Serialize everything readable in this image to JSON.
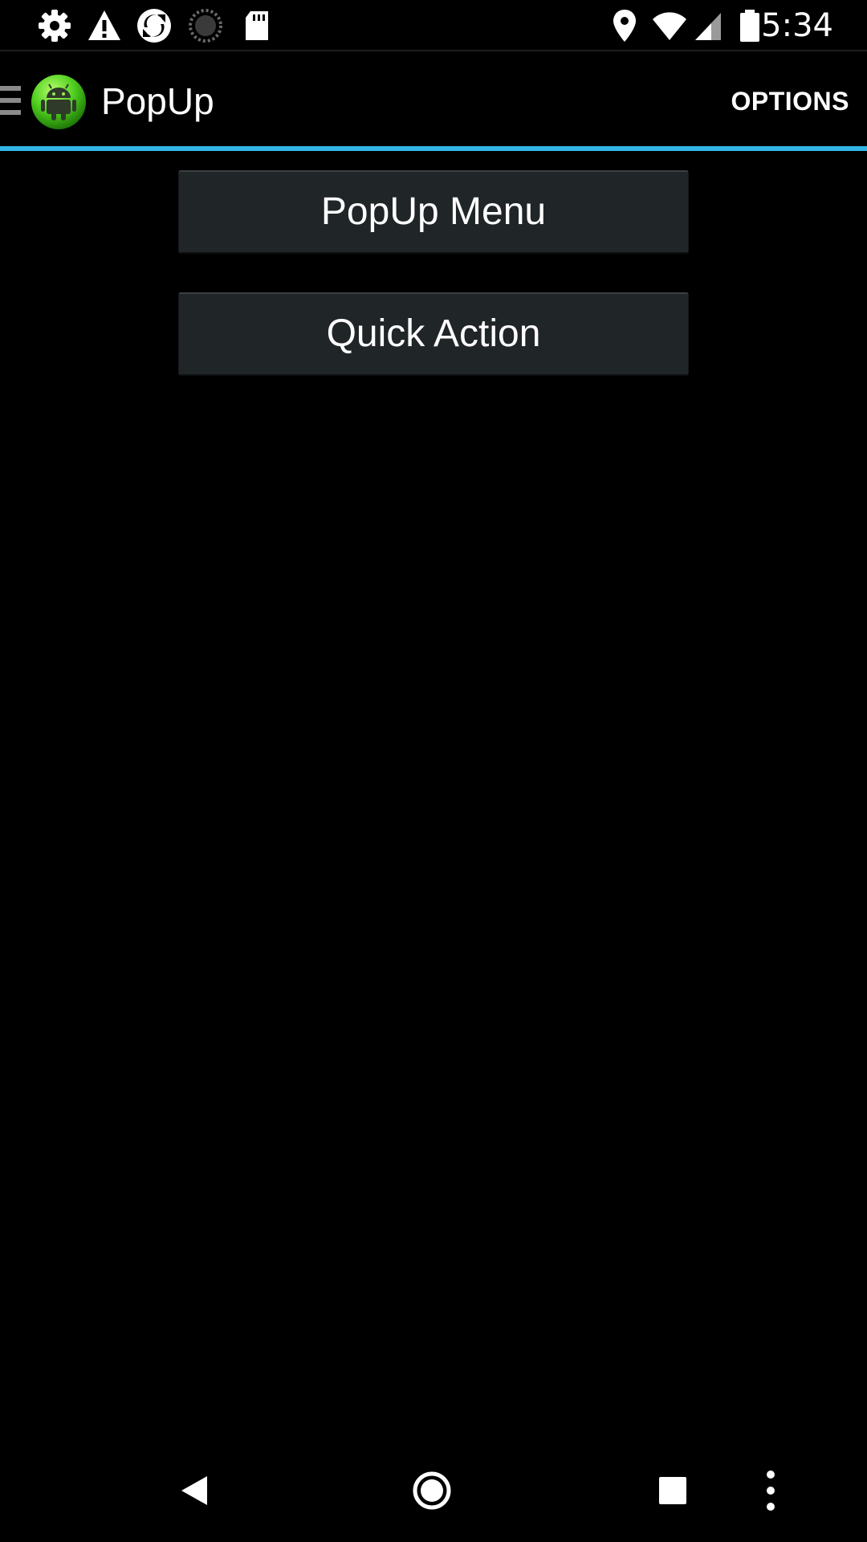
{
  "status_bar": {
    "time": "5:34",
    "left_icons": [
      "settings-icon",
      "warning-icon",
      "sync-app-icon",
      "loading-icon",
      "sd-card-icon"
    ],
    "right_icons": [
      "location-icon",
      "wifi-icon",
      "cell-signal-icon",
      "battery-icon"
    ]
  },
  "action_bar": {
    "title": "PopUp",
    "options_label": "OPTIONS",
    "accent_color": "#33b5e5"
  },
  "main": {
    "buttons": [
      {
        "label": "PopUp Menu"
      },
      {
        "label": "Quick Action"
      }
    ]
  },
  "nav_bar": {
    "buttons": [
      "back-icon",
      "home-icon",
      "recents-icon",
      "overflow-menu-icon"
    ]
  }
}
